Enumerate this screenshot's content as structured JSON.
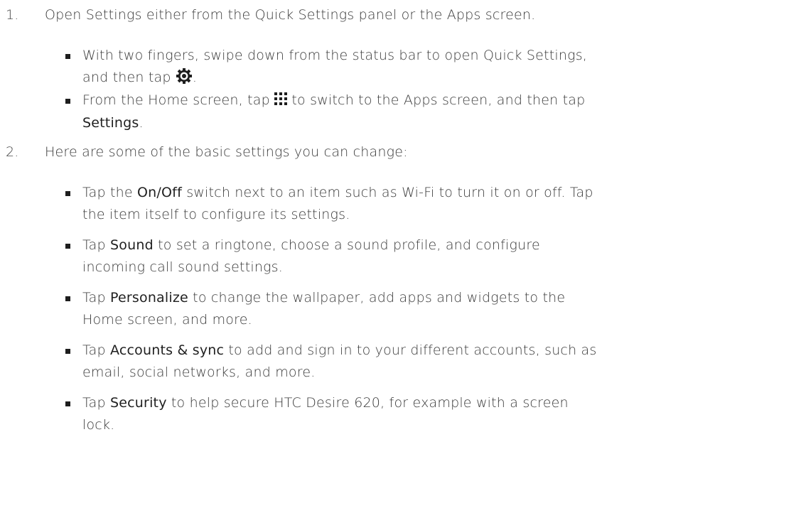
{
  "steps": [
    {
      "number": "1.",
      "text": "Open Settings either from the Quick Settings panel or the Apps screen.",
      "bullets": [
        {
          "line1": "With two fingers, swipe down from the status bar to open Quick Settings,",
          "line2_before": "and then tap ",
          "icon": "gear-icon",
          "line2_after": "."
        },
        {
          "line1_before": "From the Home screen, tap ",
          "icon": "apps-grid-icon",
          "line1_after": " to switch to the Apps screen, and then tap",
          "line2_bold": "Settings",
          "line2_after": "."
        }
      ]
    },
    {
      "number": "2.",
      "text": "Here are some of the basic settings you can change:",
      "bullets": [
        {
          "before": "Tap the ",
          "bold": "On/Off",
          "line1_after": " switch next to an item such as Wi-Fi to turn it on or off. Tap",
          "line2": "the item itself to configure its settings."
        },
        {
          "before": "Tap ",
          "bold": "Sound",
          "line1_after": " to set a ringtone, choose a sound profile, and configure",
          "line2": "incoming call sound settings."
        },
        {
          "before": "Tap ",
          "bold": "Personalize",
          "line1_after": " to change the wallpaper, add apps and widgets to the",
          "line2": "Home screen, and more."
        },
        {
          "before": "Tap ",
          "bold": "Accounts & sync",
          "line1_after": " to add and sign in to your different accounts, such as",
          "line2": "email, social networks, and more."
        },
        {
          "before": "Tap ",
          "bold": "Security",
          "line1_after": " to help secure HTC Desire 620, for example with a screen",
          "line2": "lock."
        }
      ]
    }
  ]
}
